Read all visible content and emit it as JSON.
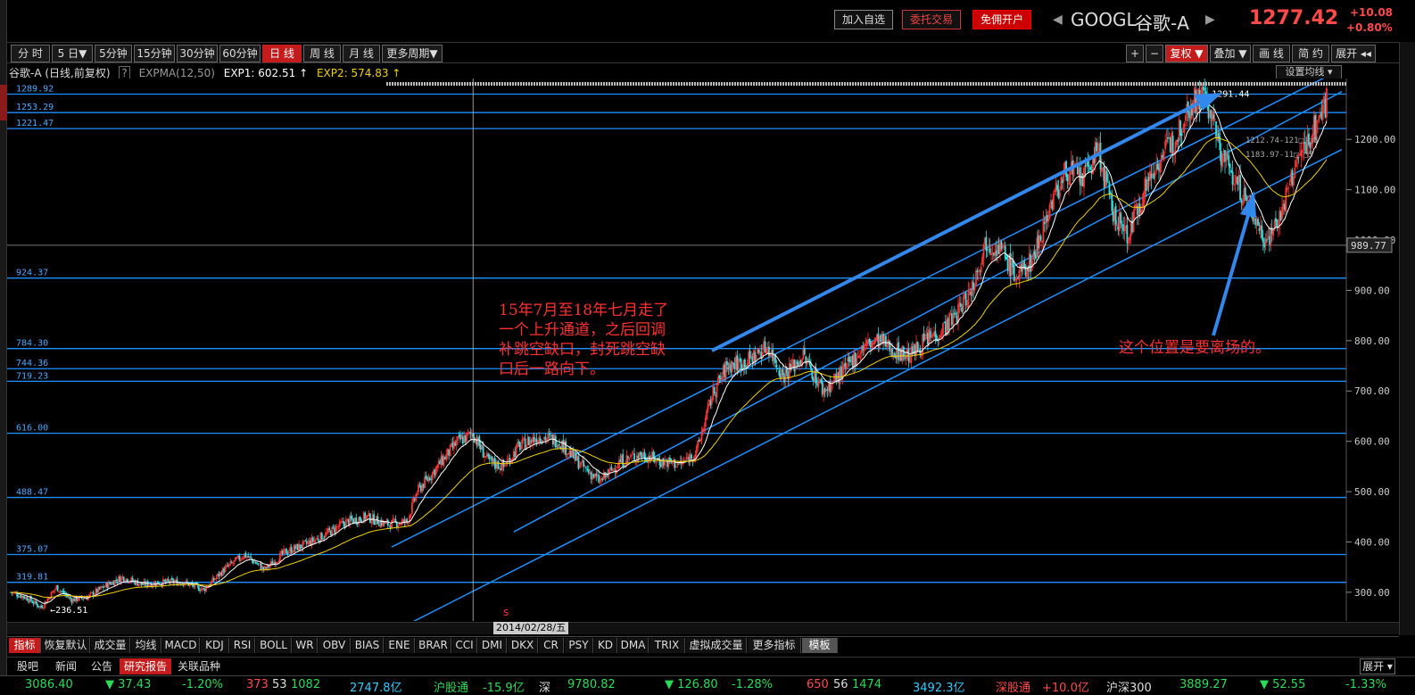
{
  "topbar": {
    "btn_watchlist": "加入自选",
    "btn_trade": "委托交易",
    "btn_open_account": "免佣开户",
    "symbol": "GOOGL",
    "name": "谷歌-A",
    "price": "1277.42",
    "change": "+10.08",
    "change_pct": "+0.80%"
  },
  "periods": [
    "分 时",
    "5 日▼",
    "5分钟",
    "15分钟",
    "30分钟",
    "60分钟",
    "日 线",
    "周 线",
    "月 线",
    "更多周期▼"
  ],
  "active_period": "日 线",
  "right_tools": [
    "+",
    "−",
    "复权 ▼",
    "叠加 ▼",
    "画 线",
    "简 约",
    "展开 ◂◂"
  ],
  "info": {
    "title": "谷歌-A (日线,前复权)",
    "help": "?",
    "indicator": "EXPMA(12,50)",
    "exp1": "EXP1: 602.51 ↑",
    "exp2": "EXP2: 574.83 ↑",
    "set_ma": "设置均线 ▾",
    "colors": {
      "exp1": "#ffffff",
      "exp2": "#f0d000"
    }
  },
  "chart_data": {
    "type": "line",
    "y_range": [
      243,
      1321
    ],
    "right_axis_ticks": [
      300,
      400,
      500,
      600,
      700,
      800,
      900,
      1000,
      1100,
      1200
    ],
    "right_axis_labels": [
      "300.00",
      "400.00",
      "500.00",
      "600.00",
      "700.00",
      "800.00",
      "900.00",
      "1000.00",
      "1100.00",
      "1200.00"
    ],
    "current_price_label": "989.77",
    "current_price_value": 989.77,
    "horizontal_levels": [
      {
        "label": "1289.92",
        "value": 1289.92
      },
      {
        "label": "1253.29",
        "value": 1253.29
      },
      {
        "label": "1221.47",
        "value": 1221.47
      },
      {
        "label": "924.37",
        "value": 924.37
      },
      {
        "label": "784.30",
        "value": 784.3
      },
      {
        "label": "744.36",
        "value": 744.36
      },
      {
        "label": "719.23",
        "value": 719.23
      },
      {
        "label": "616.00",
        "value": 616.0
      },
      {
        "label": "488.47",
        "value": 488.47
      },
      {
        "label": "375.07",
        "value": 375.07
      },
      {
        "label": "319.81",
        "value": 319.81
      }
    ],
    "price_path": [
      [
        0,
        300
      ],
      [
        3,
        290
      ],
      [
        6,
        270
      ],
      [
        9,
        310
      ],
      [
        12,
        285
      ],
      [
        15,
        290
      ],
      [
        19,
        315
      ],
      [
        22,
        330
      ],
      [
        26,
        315
      ],
      [
        30,
        320
      ],
      [
        34,
        320
      ],
      [
        38,
        305
      ],
      [
        42,
        345
      ],
      [
        46,
        375
      ],
      [
        50,
        345
      ],
      [
        54,
        380
      ],
      [
        58,
        395
      ],
      [
        62,
        415
      ],
      [
        66,
        440
      ],
      [
        70,
        450
      ],
      [
        74,
        435
      ],
      [
        78,
        440
      ],
      [
        80,
        500
      ],
      [
        84,
        550
      ],
      [
        88,
        600
      ],
      [
        91,
        615
      ],
      [
        94,
        560
      ],
      [
        97,
        550
      ],
      [
        100,
        590
      ],
      [
        104,
        610
      ],
      [
        108,
        600
      ],
      [
        112,
        555
      ],
      [
        116,
        520
      ],
      [
        120,
        560
      ],
      [
        124,
        575
      ],
      [
        128,
        560
      ],
      [
        132,
        555
      ],
      [
        135,
        580
      ],
      [
        138,
        690
      ],
      [
        141,
        750
      ],
      [
        145,
        760
      ],
      [
        149,
        790
      ],
      [
        152,
        730
      ],
      [
        156,
        770
      ],
      [
        160,
        700
      ],
      [
        164,
        740
      ],
      [
        168,
        790
      ],
      [
        171,
        800
      ],
      [
        174,
        780
      ],
      [
        177,
        770
      ],
      [
        180,
        800
      ],
      [
        183,
        820
      ],
      [
        186,
        850
      ],
      [
        189,
        900
      ],
      [
        192,
        1000
      ],
      [
        195,
        980
      ],
      [
        198,
        925
      ],
      [
        201,
        960
      ],
      [
        205,
        1080
      ],
      [
        208,
        1140
      ],
      [
        211,
        1120
      ],
      [
        214,
        1180
      ],
      [
        217,
        1050
      ],
      [
        220,
        1010
      ],
      [
        223,
        1100
      ],
      [
        226,
        1160
      ],
      [
        229,
        1200
      ],
      [
        232,
        1270
      ],
      [
        235,
        1291.44
      ],
      [
        238,
        1180
      ],
      [
        241,
        1120
      ],
      [
        244,
        1060
      ],
      [
        247,
        1000
      ],
      [
        250,
        1050
      ],
      [
        253,
        1150
      ],
      [
        256,
        1210
      ],
      [
        259,
        1277.42
      ]
    ],
    "channel_top": [
      [
        75,
        390
      ],
      [
        262,
        1340
      ]
    ],
    "channel_mid": [
      [
        99,
        420
      ],
      [
        262,
        1295
      ]
    ],
    "channel_bottom": [
      [
        75,
        220
      ],
      [
        262,
        1180
      ]
    ],
    "crosshair_x": 91,
    "date_label": "2014/02/28/五",
    "low_label": "236.51",
    "high_label": "1291.44",
    "side_labels": [
      "1212.74-121□ □8",
      "1183.97-11□ □5"
    ],
    "annotation_left": "15年7月至18年七月走了\n一个上升通道，之后回调\n补跳空缺口，封死跳空缺\n口后一路向下。",
    "annotation_right": "这个位置是要离场的。",
    "marker_s": "s"
  },
  "indicators": [
    "指标",
    "恢复默认",
    "成交量",
    "均线",
    "MACD",
    "KDJ",
    "RSI",
    "BOLL",
    "WR",
    "OBV",
    "BIAS",
    "ENE",
    "BRAR",
    "CCI",
    "DMI",
    "DKX",
    "CR",
    "PSY",
    "KD",
    "DMA",
    "TRIX",
    "虚拟成交量",
    "更多指标",
    "模板"
  ],
  "tabs": [
    "股吧",
    "新闻",
    "公告",
    "研究报告",
    "关联品种"
  ],
  "active_tab": "研究报告",
  "tab_expand": "展开 ▾",
  "ticker": [
    {
      "t": "3086.40",
      "c": "dn"
    },
    {
      "t": "▼ 37.43",
      "c": "dn"
    },
    {
      "t": "-1.20%",
      "c": "dn"
    },
    {
      "t": "373",
      "c": "up"
    },
    {
      "t": "53",
      "c": "wh"
    },
    {
      "t": "1082",
      "c": "dn"
    },
    {
      "t": "2747.8亿",
      "c": "cy"
    },
    {
      "t": "沪股通",
      "c": "dn"
    },
    {
      "t": "-15.9亿",
      "c": "dn"
    },
    {
      "t": "深",
      "c": "wh"
    },
    {
      "t": "9780.82",
      "c": "dn"
    },
    {
      "t": "▼ 126.80",
      "c": "dn"
    },
    {
      "t": "-1.28%",
      "c": "dn"
    },
    {
      "t": "650",
      "c": "up"
    },
    {
      "t": "56",
      "c": "wh"
    },
    {
      "t": "1474",
      "c": "dn"
    },
    {
      "t": "3492.3亿",
      "c": "cy"
    },
    {
      "t": "深股通",
      "c": "up"
    },
    {
      "t": "+10.0亿",
      "c": "up"
    },
    {
      "t": "沪深300",
      "c": "wh"
    },
    {
      "t": "3889.27",
      "c": "dn"
    },
    {
      "t": "▼ 52.55",
      "c": "dn"
    },
    {
      "t": "-1.33%",
      "c": "dn"
    }
  ]
}
